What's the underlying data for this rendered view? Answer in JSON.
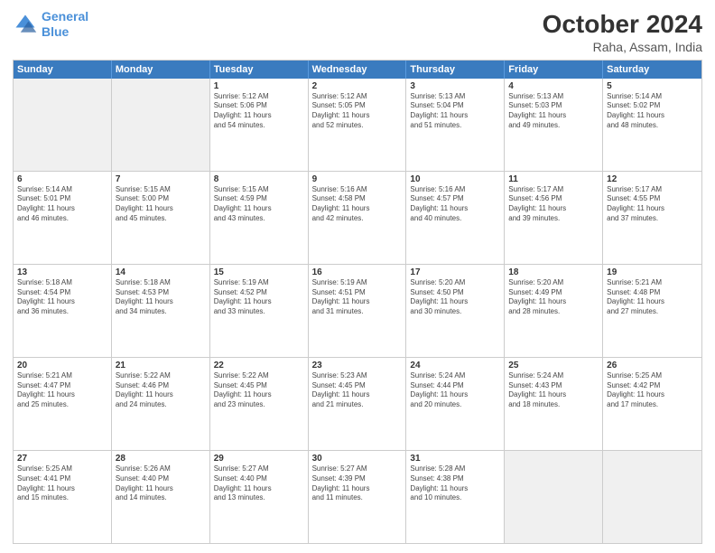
{
  "logo": {
    "line1": "General",
    "line2": "Blue"
  },
  "title": "October 2024",
  "subtitle": "Raha, Assam, India",
  "header_days": [
    "Sunday",
    "Monday",
    "Tuesday",
    "Wednesday",
    "Thursday",
    "Friday",
    "Saturday"
  ],
  "weeks": [
    [
      {
        "day": "",
        "info": "",
        "shaded": true
      },
      {
        "day": "",
        "info": "",
        "shaded": true
      },
      {
        "day": "1",
        "info": "Sunrise: 5:12 AM\nSunset: 5:06 PM\nDaylight: 11 hours\nand 54 minutes."
      },
      {
        "day": "2",
        "info": "Sunrise: 5:12 AM\nSunset: 5:05 PM\nDaylight: 11 hours\nand 52 minutes."
      },
      {
        "day": "3",
        "info": "Sunrise: 5:13 AM\nSunset: 5:04 PM\nDaylight: 11 hours\nand 51 minutes."
      },
      {
        "day": "4",
        "info": "Sunrise: 5:13 AM\nSunset: 5:03 PM\nDaylight: 11 hours\nand 49 minutes."
      },
      {
        "day": "5",
        "info": "Sunrise: 5:14 AM\nSunset: 5:02 PM\nDaylight: 11 hours\nand 48 minutes."
      }
    ],
    [
      {
        "day": "6",
        "info": "Sunrise: 5:14 AM\nSunset: 5:01 PM\nDaylight: 11 hours\nand 46 minutes."
      },
      {
        "day": "7",
        "info": "Sunrise: 5:15 AM\nSunset: 5:00 PM\nDaylight: 11 hours\nand 45 minutes."
      },
      {
        "day": "8",
        "info": "Sunrise: 5:15 AM\nSunset: 4:59 PM\nDaylight: 11 hours\nand 43 minutes."
      },
      {
        "day": "9",
        "info": "Sunrise: 5:16 AM\nSunset: 4:58 PM\nDaylight: 11 hours\nand 42 minutes."
      },
      {
        "day": "10",
        "info": "Sunrise: 5:16 AM\nSunset: 4:57 PM\nDaylight: 11 hours\nand 40 minutes."
      },
      {
        "day": "11",
        "info": "Sunrise: 5:17 AM\nSunset: 4:56 PM\nDaylight: 11 hours\nand 39 minutes."
      },
      {
        "day": "12",
        "info": "Sunrise: 5:17 AM\nSunset: 4:55 PM\nDaylight: 11 hours\nand 37 minutes."
      }
    ],
    [
      {
        "day": "13",
        "info": "Sunrise: 5:18 AM\nSunset: 4:54 PM\nDaylight: 11 hours\nand 36 minutes."
      },
      {
        "day": "14",
        "info": "Sunrise: 5:18 AM\nSunset: 4:53 PM\nDaylight: 11 hours\nand 34 minutes."
      },
      {
        "day": "15",
        "info": "Sunrise: 5:19 AM\nSunset: 4:52 PM\nDaylight: 11 hours\nand 33 minutes."
      },
      {
        "day": "16",
        "info": "Sunrise: 5:19 AM\nSunset: 4:51 PM\nDaylight: 11 hours\nand 31 minutes."
      },
      {
        "day": "17",
        "info": "Sunrise: 5:20 AM\nSunset: 4:50 PM\nDaylight: 11 hours\nand 30 minutes."
      },
      {
        "day": "18",
        "info": "Sunrise: 5:20 AM\nSunset: 4:49 PM\nDaylight: 11 hours\nand 28 minutes."
      },
      {
        "day": "19",
        "info": "Sunrise: 5:21 AM\nSunset: 4:48 PM\nDaylight: 11 hours\nand 27 minutes."
      }
    ],
    [
      {
        "day": "20",
        "info": "Sunrise: 5:21 AM\nSunset: 4:47 PM\nDaylight: 11 hours\nand 25 minutes."
      },
      {
        "day": "21",
        "info": "Sunrise: 5:22 AM\nSunset: 4:46 PM\nDaylight: 11 hours\nand 24 minutes."
      },
      {
        "day": "22",
        "info": "Sunrise: 5:22 AM\nSunset: 4:45 PM\nDaylight: 11 hours\nand 23 minutes."
      },
      {
        "day": "23",
        "info": "Sunrise: 5:23 AM\nSunset: 4:45 PM\nDaylight: 11 hours\nand 21 minutes."
      },
      {
        "day": "24",
        "info": "Sunrise: 5:24 AM\nSunset: 4:44 PM\nDaylight: 11 hours\nand 20 minutes."
      },
      {
        "day": "25",
        "info": "Sunrise: 5:24 AM\nSunset: 4:43 PM\nDaylight: 11 hours\nand 18 minutes."
      },
      {
        "day": "26",
        "info": "Sunrise: 5:25 AM\nSunset: 4:42 PM\nDaylight: 11 hours\nand 17 minutes."
      }
    ],
    [
      {
        "day": "27",
        "info": "Sunrise: 5:25 AM\nSunset: 4:41 PM\nDaylight: 11 hours\nand 15 minutes."
      },
      {
        "day": "28",
        "info": "Sunrise: 5:26 AM\nSunset: 4:40 PM\nDaylight: 11 hours\nand 14 minutes."
      },
      {
        "day": "29",
        "info": "Sunrise: 5:27 AM\nSunset: 4:40 PM\nDaylight: 11 hours\nand 13 minutes."
      },
      {
        "day": "30",
        "info": "Sunrise: 5:27 AM\nSunset: 4:39 PM\nDaylight: 11 hours\nand 11 minutes."
      },
      {
        "day": "31",
        "info": "Sunrise: 5:28 AM\nSunset: 4:38 PM\nDaylight: 11 hours\nand 10 minutes."
      },
      {
        "day": "",
        "info": "",
        "shaded": true
      },
      {
        "day": "",
        "info": "",
        "shaded": true
      }
    ]
  ]
}
